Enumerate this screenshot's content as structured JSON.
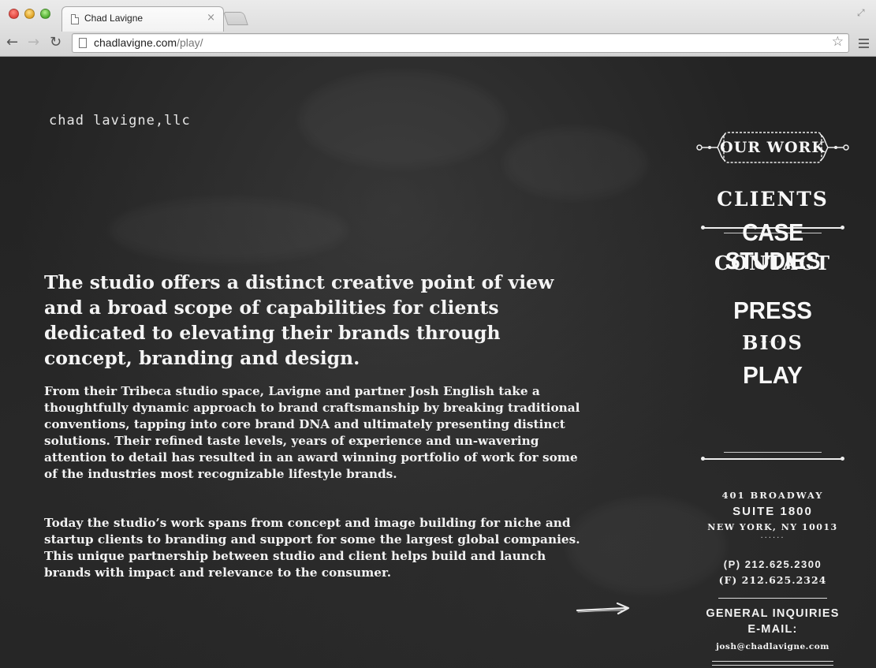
{
  "browser": {
    "tab_title": "Chad Lavigne",
    "tab_close": "×",
    "url_domain": "chadlavigne.com",
    "url_path": "/play/",
    "back_icon": "←",
    "forward_icon": "→",
    "reload_icon": "↻",
    "star_icon": "☆",
    "fullscreen_icon": "⤢"
  },
  "page": {
    "logo": "chad lavigne,llc",
    "lead": "The studio offers a distinct creative point of view and a broad scope of capabilities for clients dedicated to elevating their brands through concept, branding and design.",
    "paragraph1": "From their Tribeca studio space, Lavigne and partner Josh English take a thoughtfully dynamic approach to brand craftsmanship by breaking traditional conventions, tapping into core brand DNA and ultimately presenting distinct solutions. Their refined taste levels, years of experience and un-wavering attention to detail has resulted in an award winning portfolio of work for some of the industries most recognizable lifestyle brands.",
    "paragraph2": "Today the studio’s work spans from concept and image building for niche and startup clients to branding and support for some the largest global companies. This unique partnership between studio and client helps build and launch brands with impact and relevance to the consumer."
  },
  "nav": {
    "our_work": "OUR WORK",
    "clients": "CLIENTS",
    "case_studies": "CASE STUDIES",
    "contact": "CONTACT",
    "dots": "......",
    "press": "PRESS",
    "bios": "BIOS",
    "play": "PLAY"
  },
  "contact_info": {
    "address_line1": "401 BROADWAY",
    "address_line2": "SUITE 1800",
    "address_line3": "NEW YORK, NY 10013",
    "dots": "......",
    "phone": "(P) 212.625.2300",
    "fax": "(F) 212.625.2324",
    "inquiries_line1": "GENERAL INQUIRIES",
    "inquiries_line2": "E-MAIL:",
    "email": "josh@chadlavigne.com"
  }
}
